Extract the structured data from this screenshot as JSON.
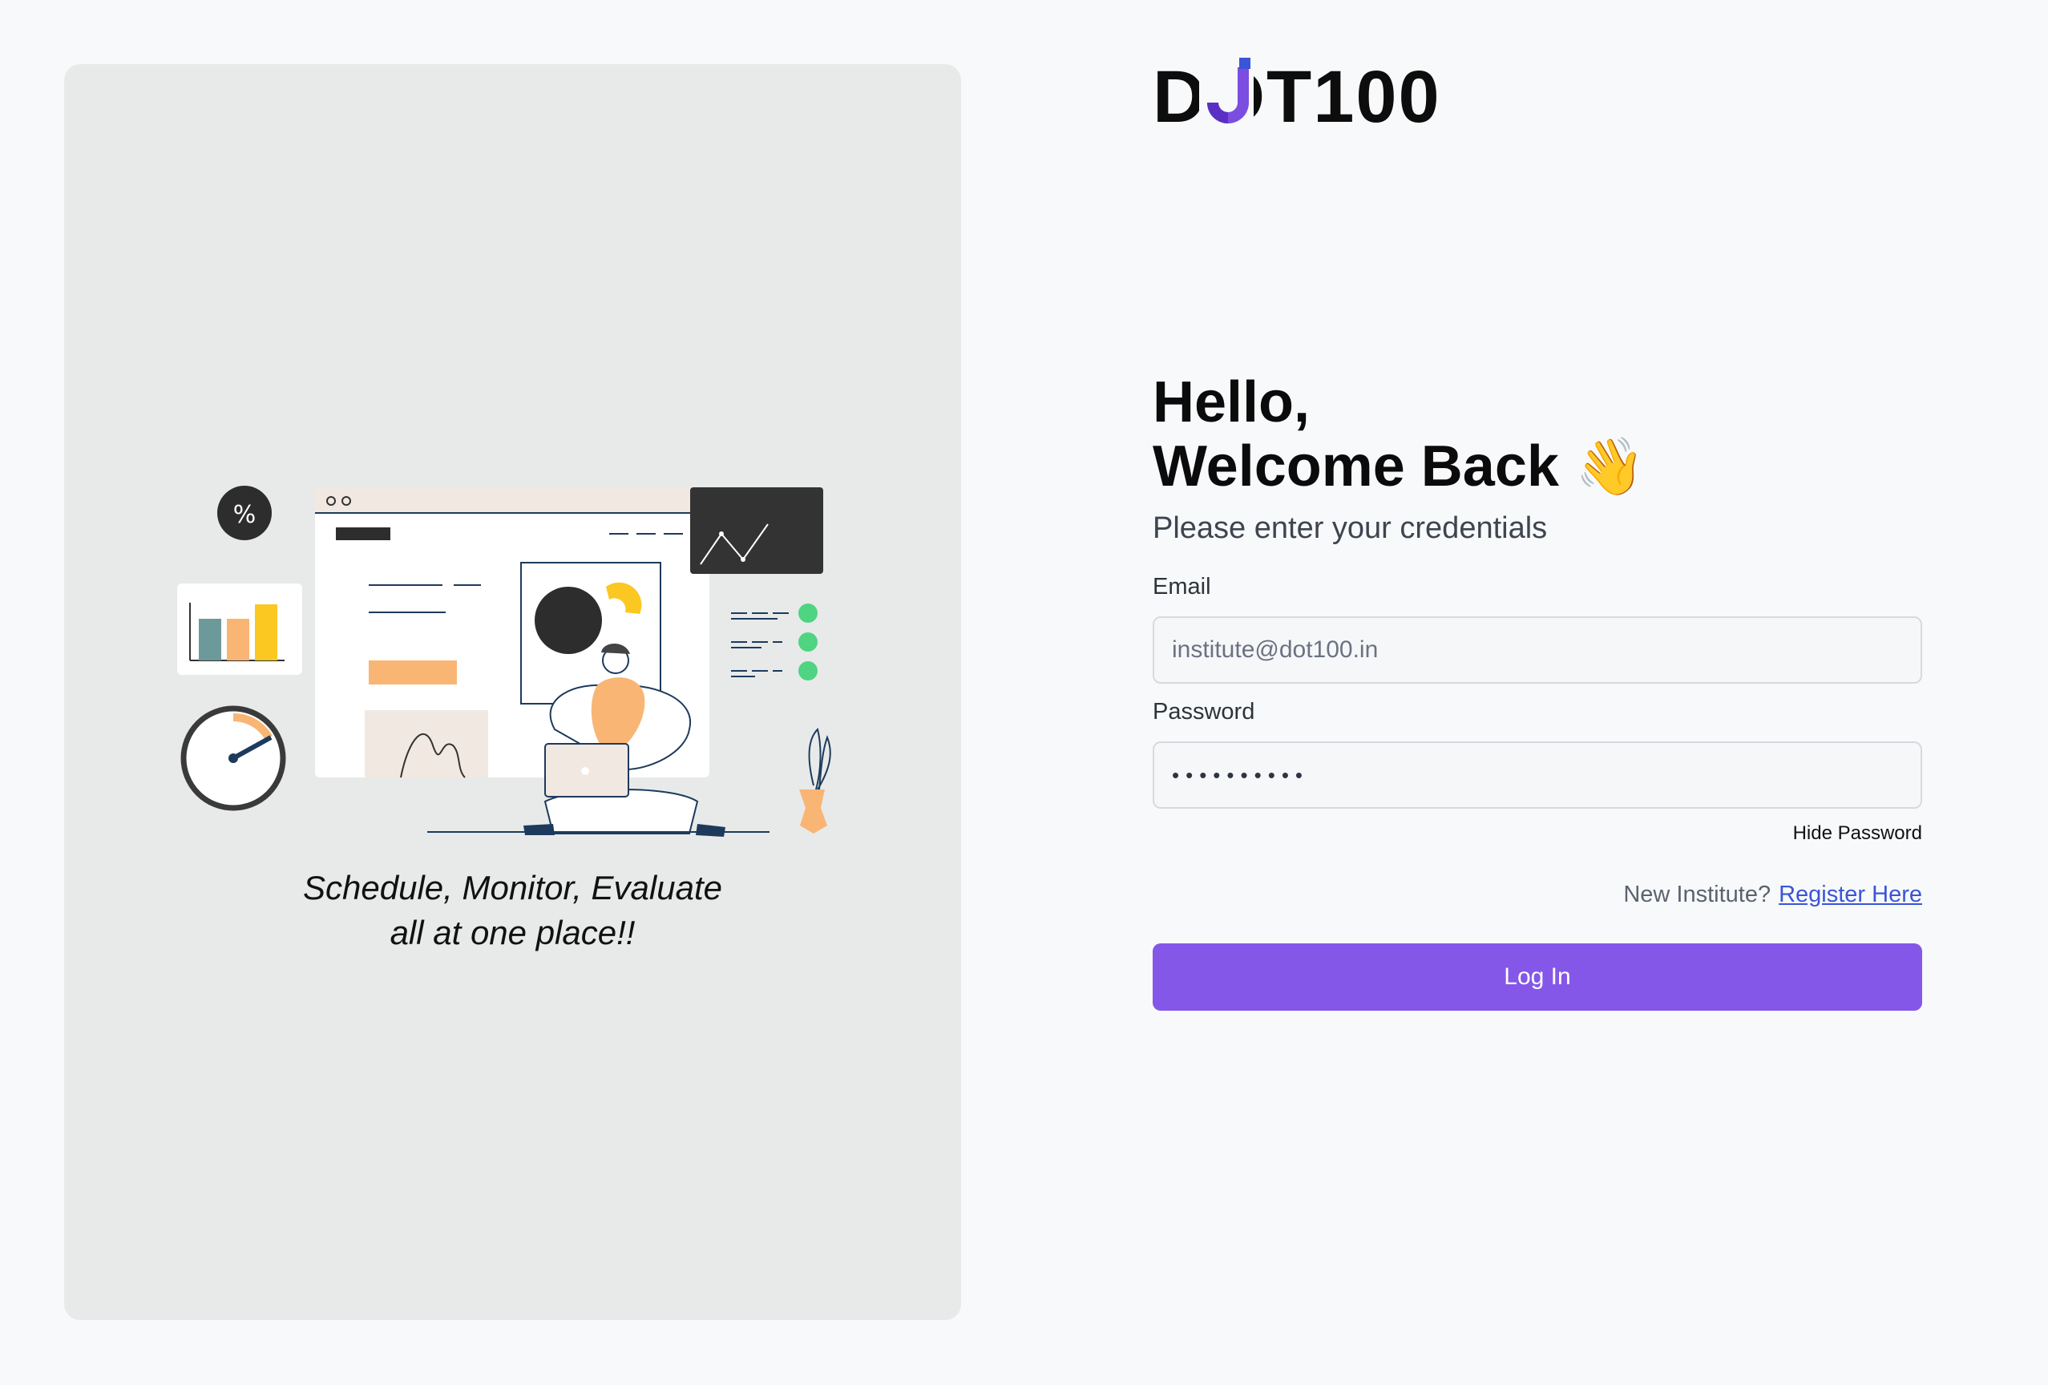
{
  "brand": {
    "logo_text": "DOT100",
    "logo_icon": "dot100-logo-icon"
  },
  "left": {
    "tagline_line1": "Schedule, Monitor, Evaluate",
    "tagline_line2": "all at one place!!"
  },
  "form": {
    "heading_line1": "Hello,",
    "heading_line2": "Welcome Back",
    "wave_emoji": "👋",
    "subheading": "Please enter your credentials",
    "email_label": "Email",
    "email_placeholder": "institute@dot100.in",
    "password_label": "Password",
    "password_value": "••••••••••",
    "hide_password": "Hide Password",
    "new_institute": "New Institute?",
    "register_link": "Register Here",
    "login_button": "Log In"
  },
  "colors": {
    "accent": "#8457e8",
    "link": "#3a55d8",
    "panel_bg": "#e7eae9",
    "page_bg": "#f8f9fa"
  }
}
